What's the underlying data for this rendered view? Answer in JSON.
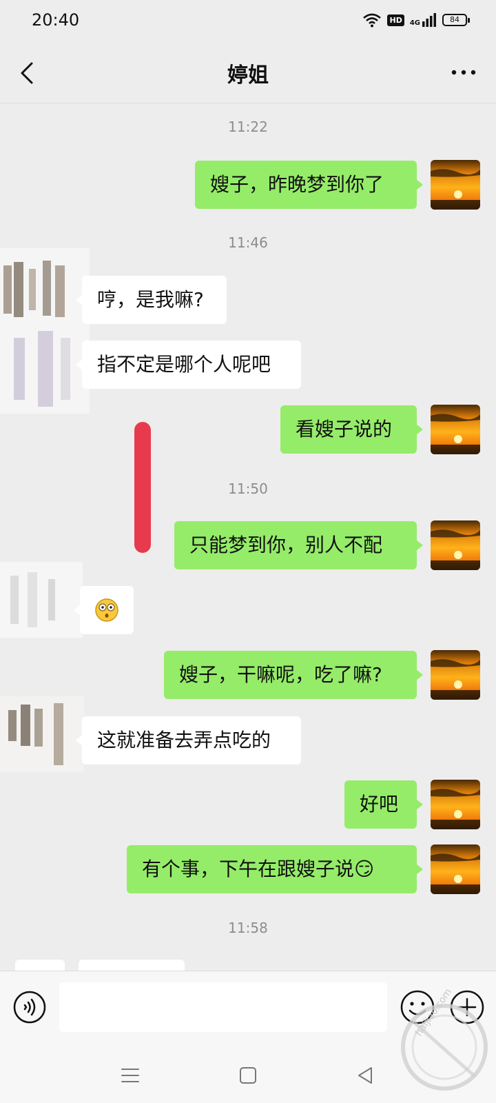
{
  "status_bar": {
    "time": "20:40",
    "hd": "HD",
    "network": "4G",
    "battery": "84"
  },
  "header": {
    "title": "婷姐"
  },
  "messages": {
    "t1": "11:22",
    "m1": "嫂子，昨晚梦到你了",
    "t2": "11:46",
    "m2": "哼，是我嘛?",
    "m3": "指不定是哪个人呢吧",
    "m4": "看嫂子说的",
    "t3": "11:50",
    "m5": "只能梦到你，别人不配",
    "m6": "😳",
    "m7": "嫂子，干嘛呢，吃了嘛?",
    "m8": "这就准备去弄点吃的",
    "m9": "好吧",
    "m10": "有个事，下午在跟嫂子说😏",
    "t4": "11:58"
  },
  "input": {
    "value": ""
  },
  "watermark": {
    "text": "haijiao.com"
  },
  "colors": {
    "outgoing_bubble": "#95ec69",
    "incoming_bubble": "#ffffff",
    "background": "#ededed",
    "redaction_mark": "#e83a4d"
  },
  "icons": {
    "back": "chevron-left-icon",
    "more": "more-dots-icon",
    "voice": "voice-icon",
    "emoji": "smiley-icon",
    "plus": "plus-icon",
    "sys_menu": "menu-lines-icon",
    "sys_home": "square-icon",
    "sys_back": "triangle-left-icon"
  }
}
